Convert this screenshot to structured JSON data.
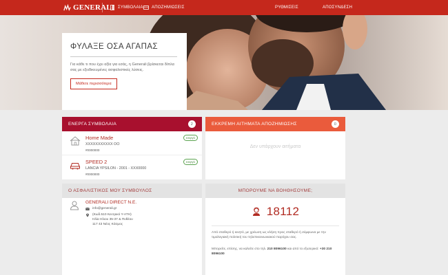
{
  "header": {
    "logo_text": "GENERALI",
    "nav_left": [
      {
        "label": "ΣΥΜΒΟΛΑΙΑ",
        "icon": "document-icon"
      },
      {
        "label": "ΑΠΟΖΗΜΙΩΣΕΙΣ",
        "icon": "claims-icon"
      }
    ],
    "nav_right": [
      {
        "label": "ΡΥΘΜΙΣΕΙΣ"
      },
      {
        "label": "ΑΠΟΣΥΝΔΕΣΗ"
      }
    ],
    "brand_color": "#c5281c"
  },
  "hero": {
    "title": "ΦΥΛΑΞΕ ΟΣΑ ΑΓΑΠΑΣ",
    "text": "Για κάθε τι που έχει αξία για εσάς, η Generali βρίσκεται δίπλα σας με εξειδικευμένες ασφαλιστικές λύσεις.",
    "button": "Μάθετε περισσότερα"
  },
  "contracts": {
    "title": "ΕΝΕΡΓΑ ΣΥΜΒΟΛΑΙΑ",
    "count": "2",
    "items": [
      {
        "name": "Home Made",
        "sub": "XXXXXXXXXXX ΟΟ",
        "number": "#0000000",
        "status": "ενεργό",
        "icon": "house-icon"
      },
      {
        "name": "SPEED 2",
        "sub": "LANCIA YPSILON - 2001 - XXX0000",
        "number": "#0000000",
        "status": "ενεργό",
        "icon": "car-icon"
      }
    ]
  },
  "claims": {
    "title": "ΕΚΚΡΕΜΗ ΑΙΤΗΜΑΤΑ ΑΠΟΖΗΜΙΩΣΗΣ",
    "count": "0",
    "empty": "Δεν υπάρχουν αιτήματα"
  },
  "advisor": {
    "title": "Ο ΑΣΦΑΛΙΣΤΙΚΟΣ ΜΟΥ ΣΥΜΒΟΥΛΟΣ",
    "name": "GENERALI DIRECT Ν.Ε.",
    "email": "info@generali.gr",
    "address_lines": [
      "(Κωδ.510 Κεντρικό Υ-ΑΤΗ)",
      "Ηλία Ηλιου 35-37 & Πυθέου",
      "117 43 Νέος Κόσμος"
    ]
  },
  "help": {
    "title": "ΜΠΟΡΟΥΜΕ ΝΑ ΒΟΗΘΗΣΟΥΜΕ;",
    "phone": "18112",
    "text1": "Από σταθερό ή κινητό, με χρέωση ως κλήση προς σταθερό ή σύμφωνα με την τιμολογιακή πολιτική του τηλεπικοινωνιακού παρόχου σας.",
    "text2_prefix": "Μπορείτε, επίσης, να καλείτε στο τηλ. ",
    "text2_phone1": "210 8096100",
    "text2_middle": " και από το εξωτερικό: ",
    "text2_phone2": "+30 210 8096100"
  }
}
